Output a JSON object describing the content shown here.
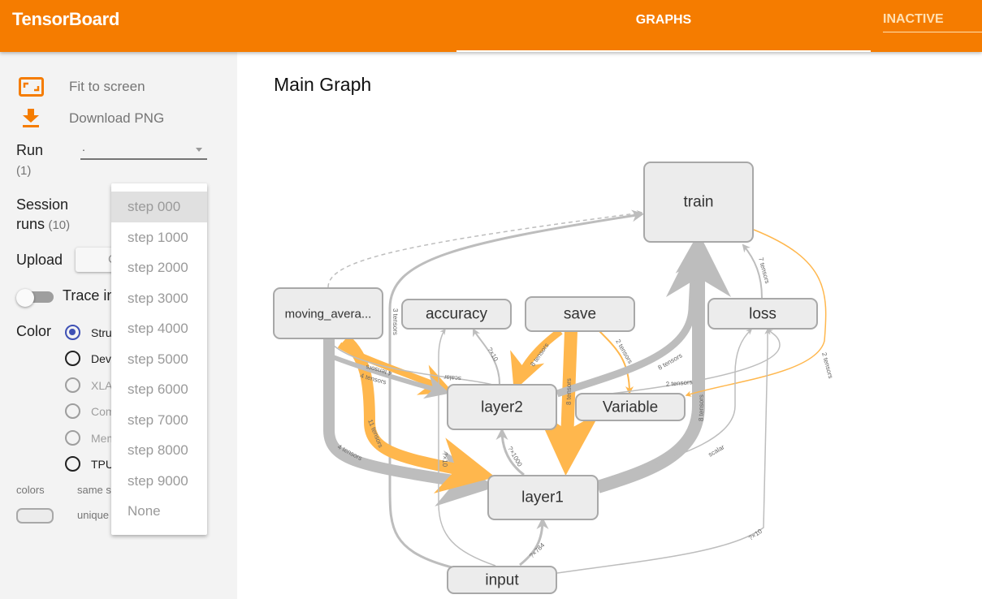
{
  "header": {
    "brand": "TensorBoard",
    "tabs": [
      {
        "label": "GRAPHS",
        "active": true
      },
      {
        "label": "INACTIVE",
        "active": false
      }
    ],
    "brand_color": "#f57c00"
  },
  "sidebar": {
    "fit_to_screen": "Fit to screen",
    "download_png": "Download PNG",
    "run": {
      "label": "Run",
      "count": "(1)",
      "value": "."
    },
    "session_runs": {
      "label_line1": "Session",
      "label_line2": "runs",
      "count": "(10)"
    },
    "upload": {
      "label": "Upload",
      "button_label": "Choose File"
    },
    "trace": {
      "label": "Trace inputs",
      "enabled": false
    },
    "color": {
      "label": "Color",
      "options": [
        {
          "label": "Structure",
          "selected": true
        },
        {
          "label": "Device",
          "selected": false
        },
        {
          "label": "XLA Cluster",
          "selected": false
        },
        {
          "label": "Compute time",
          "selected": false
        },
        {
          "label": "Memory",
          "selected": false
        },
        {
          "label": "TPU Compatibility",
          "selected": false
        }
      ]
    },
    "legend": {
      "colors_label": "colors",
      "same_label": "same substructure",
      "unique_label": "unique substructure"
    }
  },
  "session_dropdown": {
    "selected": "step 000",
    "options": [
      "step 000",
      "step 1000",
      "step 2000",
      "step 3000",
      "step 4000",
      "step 5000",
      "step 6000",
      "step 7000",
      "step 8000",
      "step 9000",
      "None"
    ]
  },
  "graph": {
    "title": "Main Graph",
    "nodes": {
      "train": "train",
      "moving_average": "moving_avera...",
      "accuracy": "accuracy",
      "save": "save",
      "loss": "loss",
      "layer2": "layer2",
      "variable": "Variable",
      "layer1": "layer1",
      "input": "input"
    },
    "edge_labels": {
      "input_train": "3 tensors",
      "ma_layer2_orange": "4 tensors",
      "ma_layer2_gray": "4 tensors",
      "ma_layer1_orange": "11 tensors",
      "ma_layer1_gray": "4 tensors",
      "layer2_accuracy": "?×10",
      "layer2_scalar": "scalar",
      "save_layer2": "8 tensors",
      "save_layer1": "8 tensors",
      "save_variable": "2 tensors",
      "layer2_train": "8 tensors",
      "variable_loss": "2 tensors",
      "layer1_train": "8 tensors",
      "loss_train": "7 tensors",
      "train_variable": "2 tensors",
      "input_accuracy": "?×10",
      "layer1_layer2": "?×1000",
      "input_layer1": "?×784",
      "layer1_loss": "scalar",
      "input_loss": "?×10"
    },
    "colors": {
      "orange_edge": "#ffb74d",
      "gray_edge": "#bdbdbd",
      "node_fill": "#ececec",
      "node_stroke": "#a8a8a8"
    }
  }
}
